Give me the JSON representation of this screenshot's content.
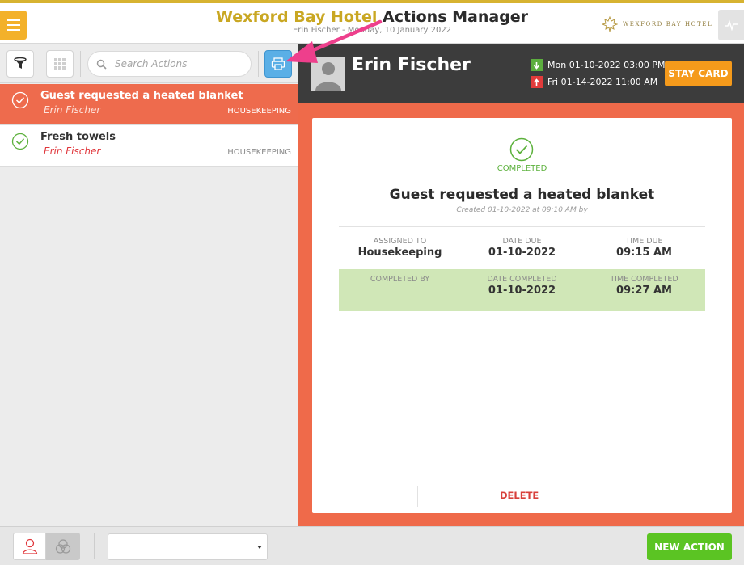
{
  "header": {
    "hotel_name": "Wexford Bay Hotel",
    "app_name": "Actions Manager",
    "user": "Erin Fischer",
    "date": "Monday, 10 January 2022",
    "logo_text": "WEXFORD BAY HOTEL"
  },
  "toolbar": {
    "search_placeholder": "Search Actions"
  },
  "actions": [
    {
      "title": "Guest requested a heated blanket",
      "guest": "Erin Fischer",
      "department": "HOUSEKEEPING",
      "selected": true
    },
    {
      "title": "Fresh towels",
      "guest": "Erin Fischer",
      "department": "HOUSEKEEPING",
      "selected": false
    }
  ],
  "guest": {
    "name": "Erin Fischer",
    "arrival": "Mon 01-10-2022  03:00 PM",
    "departure": "Fri 01-14-2022  11:00 AM",
    "stay_card_label": "STAY CARD"
  },
  "detail": {
    "status": "COMPLETED",
    "title": "Guest requested a heated blanket",
    "created": "Created 01-10-2022 at 09:10 AM by",
    "assigned_to_label": "ASSIGNED TO",
    "assigned_to": "Housekeeping",
    "date_due_label": "DATE DUE",
    "date_due": "01-10-2022",
    "time_due_label": "TIME DUE",
    "time_due": "09:15 AM",
    "completed_by_label": "COMPLETED BY",
    "completed_by": "",
    "date_completed_label": "DATE COMPLETED",
    "date_completed": "01-10-2022",
    "time_completed_label": "TIME COMPLETED",
    "time_completed": "09:27 AM",
    "delete_label": "DELETE"
  },
  "bottom": {
    "select_value": "",
    "new_action_label": "NEW ACTION"
  },
  "colors": {
    "brand_gold": "#c9a722",
    "selected_row": "#ee6b4d",
    "completed_green": "#5cb13c",
    "stay_card": "#f59a1b",
    "new_action": "#5bc423",
    "annotation_arrow": "#ee3f8c"
  }
}
